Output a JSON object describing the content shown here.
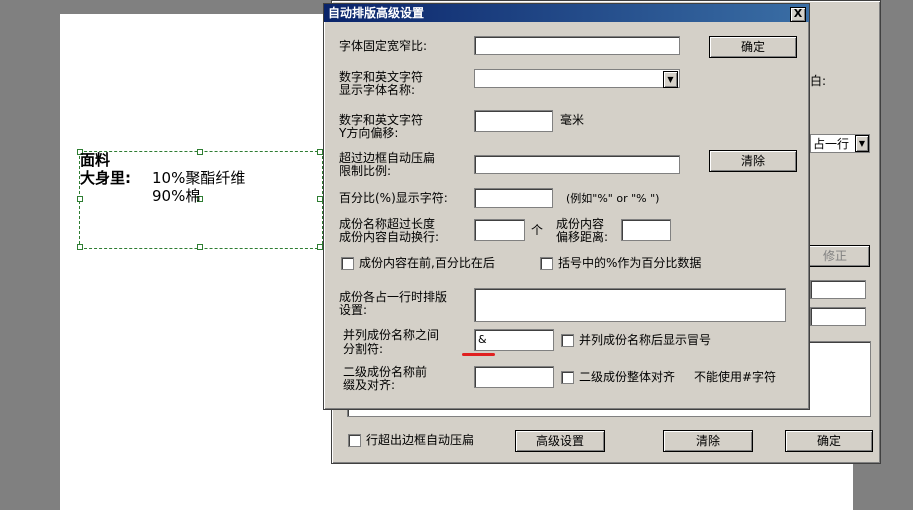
{
  "canvas": {
    "label": {
      "line1": "面料",
      "line2_label": "大身里:",
      "line2_value": "10%聚酯纤维",
      "line3_value": "90%棉"
    }
  },
  "bg_dialog": {
    "partial_label": "白:",
    "partial_dropdown": "占一行",
    "fix_button": "修正",
    "bottom_checkbox": "行超出边框自动压扁",
    "advanced_button": "高级设置",
    "clear_button": "清除",
    "ok_button": "确定"
  },
  "dialog": {
    "title": "自动排版高级设置",
    "close": "X",
    "font_ratio_label": "字体固定宽窄比:",
    "ok_button": "确定",
    "font_name_label_1": "数字和英文字符",
    "font_name_label_2": "显示字体名称:",
    "y_offset_label_1": "数字和英文字符",
    "y_offset_label_2": "Y方向偏移:",
    "y_offset_unit": "毫米",
    "compress_label_1": "超过边框自动压扁",
    "compress_label_2": "限制比例:",
    "clear_button": "清除",
    "percent_label": "百分比(%)显示字符:",
    "percent_hint": "(例如\"%\" or \"% \")",
    "name_len_label_1": "成份名称超过长度",
    "name_len_label_2": "成份内容自动换行:",
    "name_len_unit": "个",
    "offset_label_1": "成份内容",
    "offset_label_2": "偏移距离:",
    "chk_content_first": "成份内容在前,百分比在后",
    "chk_bracket_percent": "括号中的%作为百分比数据",
    "row_layout_label_1": "成份各占一行时排版",
    "row_layout_label_2": "设置:",
    "separator_label_1": "并列成份名称之间",
    "separator_label_2": "分割符:",
    "separator_value": "&",
    "chk_show_colon": "并列成份名称后显示冒号",
    "level2_label_1": "二级成份名称前",
    "level2_label_2": "缀及对齐:",
    "chk_level2_align": "二级成份整体对齐",
    "no_hash_note": "不能使用#字符"
  }
}
